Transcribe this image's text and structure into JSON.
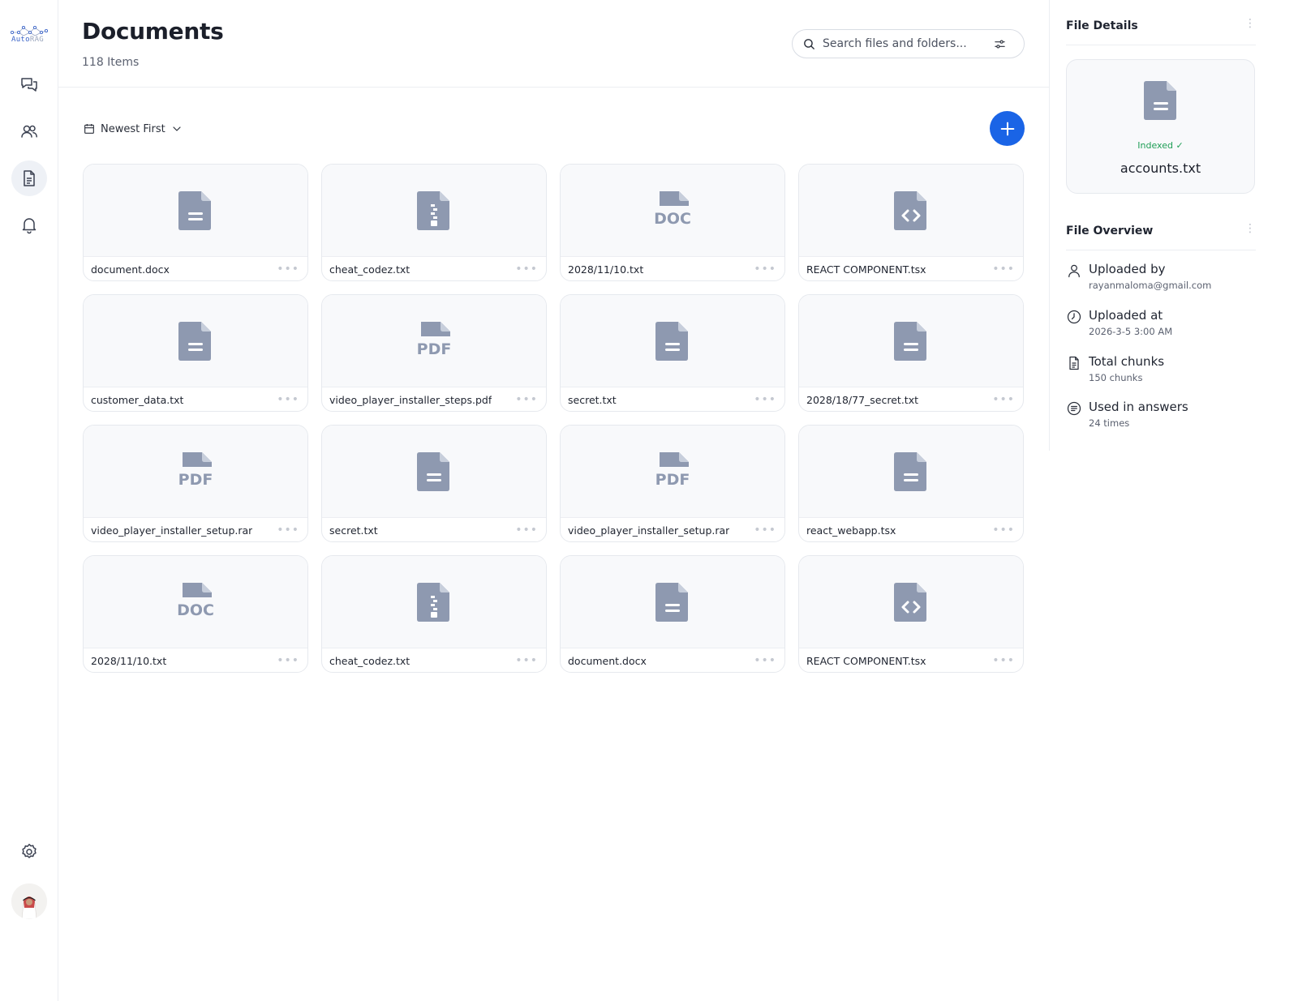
{
  "app": {
    "logo_primary": "Auto",
    "logo_secondary": "RAG"
  },
  "header": {
    "title": "Documents",
    "item_count": "118 Items",
    "search_placeholder": "Search files and folders..."
  },
  "toolbar": {
    "sort_label": "Newest First"
  },
  "files": [
    {
      "name": "document.docx",
      "icon": "text-file-icon"
    },
    {
      "name": "cheat_codez.txt",
      "icon": "archive-file-icon"
    },
    {
      "name": "2028/11/10.txt",
      "icon": "doc-file-icon"
    },
    {
      "name": "REACT COMPONENT.tsx",
      "icon": "code-file-icon"
    },
    {
      "name": "customer_data.txt",
      "icon": "text-file-icon"
    },
    {
      "name": "video_player_installer_steps.pdf",
      "icon": "pdf-file-icon"
    },
    {
      "name": "secret.txt",
      "icon": "text-file-icon"
    },
    {
      "name": "2028/18/77_secret.txt",
      "icon": "text-file-icon"
    },
    {
      "name": "video_player_installer_setup.rar",
      "icon": "pdf-file-icon"
    },
    {
      "name": "secret.txt",
      "icon": "text-file-icon"
    },
    {
      "name": "video_player_installer_setup.rar",
      "icon": "pdf-file-icon"
    },
    {
      "name": "react_webapp.tsx",
      "icon": "text-file-icon"
    },
    {
      "name": "2028/11/10.txt",
      "icon": "doc-file-icon"
    },
    {
      "name": "cheat_codez.txt",
      "icon": "archive-file-icon"
    },
    {
      "name": "document.docx",
      "icon": "text-file-icon"
    },
    {
      "name": "REACT COMPONENT.tsx",
      "icon": "code-file-icon"
    }
  ],
  "details": {
    "title": "File Details",
    "status": "Indexed ✓",
    "file_name": "accounts.txt"
  },
  "overview": {
    "title": "File Overview",
    "items": [
      {
        "label": "Uploaded by",
        "value": "rayanmaloma@gmail.com",
        "icon": "user-icon"
      },
      {
        "label": "Uploaded at",
        "value": "2026-3-5  3:00 AM",
        "icon": "clock-icon"
      },
      {
        "label": "Total chunks",
        "value": "150 chunks",
        "icon": "document-icon"
      },
      {
        "label": "Used in answers",
        "value": "24 times",
        "icon": "list-circle-icon"
      }
    ]
  },
  "colors": {
    "accent": "#1a64e6",
    "file_icon": "#8e99b0",
    "indexed": "#1e9e55"
  }
}
